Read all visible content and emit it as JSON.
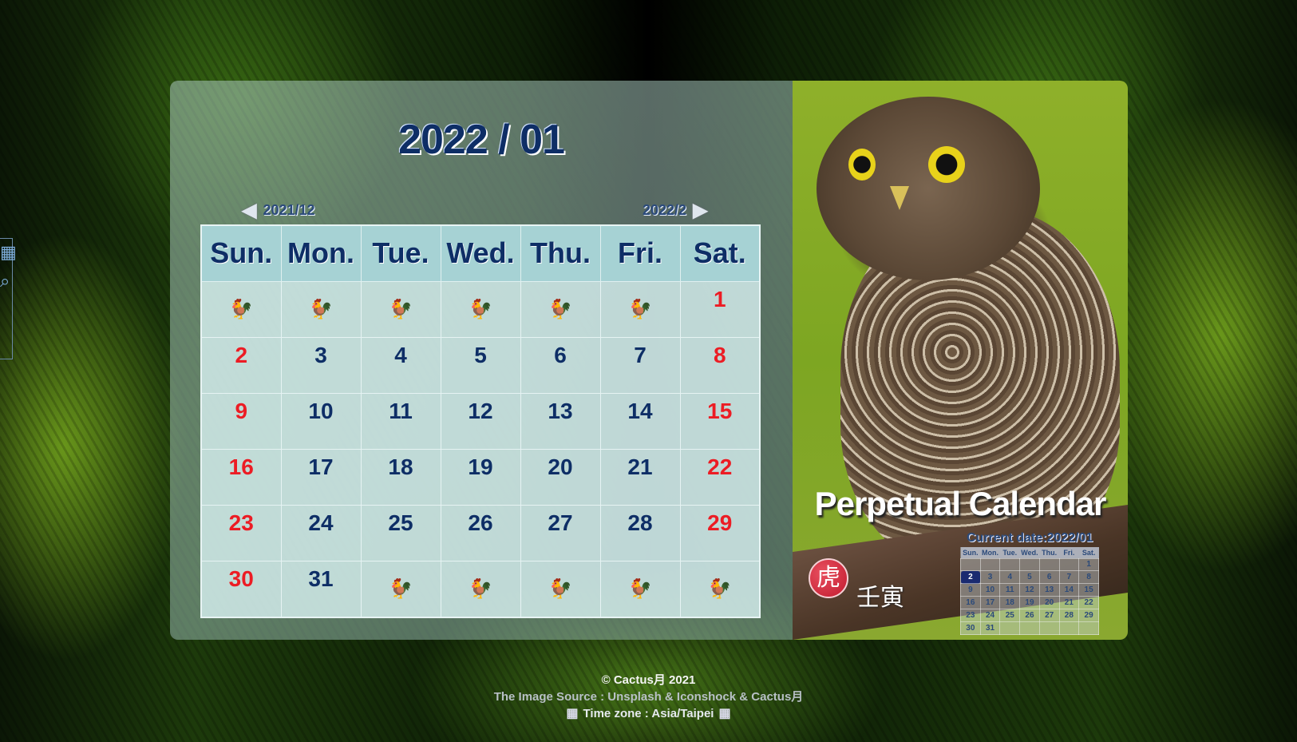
{
  "header": {
    "month_title": "2022 / 01",
    "prev_label": "2021/12",
    "next_label": "2022/2",
    "prev_arrow": "◀",
    "next_arrow": "▶"
  },
  "weekdays": [
    "Sun.",
    "Mon.",
    "Tue.",
    "Wed.",
    "Thu.",
    "Fri.",
    "Sat."
  ],
  "weeks": [
    [
      "",
      "",
      "",
      "",
      "",
      "",
      "1"
    ],
    [
      "2",
      "3",
      "4",
      "5",
      "6",
      "7",
      "8"
    ],
    [
      "9",
      "10",
      "11",
      "12",
      "13",
      "14",
      "15"
    ],
    [
      "16",
      "17",
      "18",
      "19",
      "20",
      "21",
      "22"
    ],
    [
      "23",
      "24",
      "25",
      "26",
      "27",
      "28",
      "29"
    ],
    [
      "30",
      "31",
      "",
      "",
      "",
      "",
      ""
    ]
  ],
  "empty_cell_icon": "rooster-icon",
  "empty_cell_glyph": "🐓",
  "colors": {
    "weekday_number": "#0e2e66",
    "weekend_number": "#ec1c24",
    "header_bg": "#a6d2d4"
  },
  "photo_panel": {
    "title": "Perpetual Calendar",
    "zodiac_char": "虎",
    "ganzhi": "壬寅",
    "current_date_label": "Current date:2022/01",
    "mini_weekdays": [
      "Sun.",
      "Mon.",
      "Tue.",
      "Wed.",
      "Thu.",
      "Fri.",
      "Sat."
    ],
    "mini_weeks": [
      [
        "",
        "",
        "",
        "",
        "",
        "",
        "1"
      ],
      [
        "2",
        "3",
        "4",
        "5",
        "6",
        "7",
        "8"
      ],
      [
        "9",
        "10",
        "11",
        "12",
        "13",
        "14",
        "15"
      ],
      [
        "16",
        "17",
        "18",
        "19",
        "20",
        "21",
        "22"
      ],
      [
        "23",
        "24",
        "25",
        "26",
        "27",
        "28",
        "29"
      ],
      [
        "30",
        "31",
        "",
        "",
        "",
        "",
        ""
      ]
    ],
    "mini_today": "2"
  },
  "footer": {
    "copyright": "©  Cactus月  2021",
    "image_source": "The Image Source : Unsplash  &  Iconshock  &  Cactus月",
    "timezone": "Time zone : Asia/Taipei"
  }
}
